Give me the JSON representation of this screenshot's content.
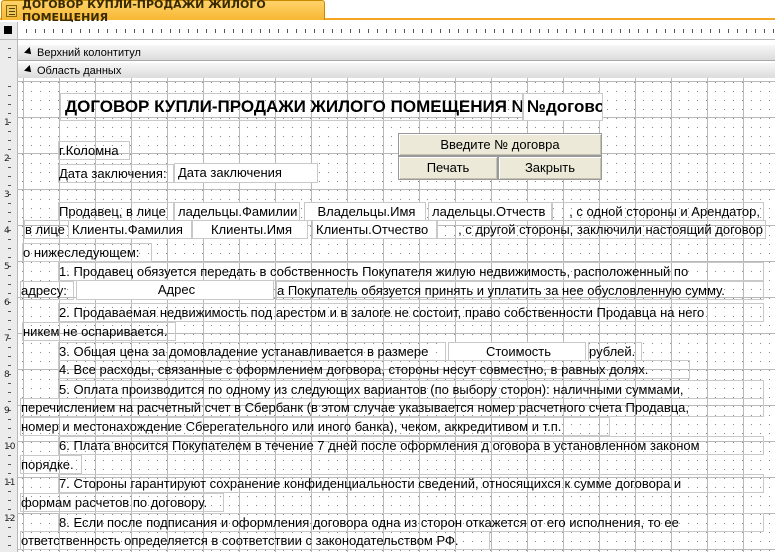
{
  "window": {
    "tab_title": "ДОГОВОР КУПЛИ-ПРОДАЖИ ЖИЛОГО ПОМЕЩЕНИЯ"
  },
  "sections": {
    "header": "Верхний колонтитул",
    "detail": "Область данных"
  },
  "ruler": {
    "numbers": [
      "1",
      "2",
      "3",
      "4",
      "5",
      "6",
      "7",
      "8",
      "9",
      "10",
      "11",
      "12"
    ]
  },
  "form": {
    "title_label": "ДОГОВОР КУПЛИ-ПРОДАЖИ ЖИЛОГО ПОМЕЩЕНИЯ №",
    "contract_no_field": "№догово",
    "city": "г.Коломна",
    "date_label": "Дата заключения:",
    "date_field": "Дата заключения",
    "buttons": {
      "enter_no": "Введите № договра",
      "print": "Печать",
      "close": "Закрыть"
    },
    "line1": {
      "seller_prefix": "Продавец, в лице",
      "owner_last": "ладельцы.Фамилии",
      "owner_first": "Владельцы.Имя",
      "owner_middle": "ладельцы.Отчеств",
      "suffix": ", с одной стороны  и  Арендатор,"
    },
    "line2": {
      "prefix": "в лице",
      "client_last": "Клиенты.Фамилия",
      "client_first": "Клиенты.Имя",
      "client_middle": "Клиенты.Отчество",
      "suffix": ", с другой стороны, заключили настоящий договор"
    },
    "line3": "о нижеследующем:",
    "p1a": "1. Продавец  обязуется передать  в  собственность  Покупателя  жилую недвижимость,  расположенный  по",
    "p1b_prefix": "адресу:",
    "address_field": "Адрес",
    "p1b_suffix": "а Покупатель  обязуется принять и уплатить за нее обусловленную сумму.",
    "p2a": "2. Продаваемая недвижимость под арестом  и  в залоге  не  состоит,  право собственности Продавца на него",
    "p2b": "никем не оспаривается.",
    "p3_prefix": "3.  Общая цена за домовладение устанавливается в размере",
    "price_field": "Стоимость",
    "p3_suffix": "рублей.",
    "p4": "4.  Все  расходы,  связанные  с оформлением  договора, стороны  несут совместно, в равных долях.",
    "p5a": "5. Оплата  производится  по  одному  из  следующих  вариантов  (по  выбору  сторон):  наличными  суммами,",
    "p5b": "перечислением  на  расчетный  счет  в  Сбербанк  (в  этом  случае  указывается  номер  расчетного  счета  Продавца,",
    "p5c": "номер  и местонахождение Сберегательного  или иного банка), чеком, аккредитивом и т.п.",
    "p6a": "6. Плата вносится  Покупателем  в  течение  7  дней  после  оформления д оговора  в установленном  законом",
    "p6b": "порядке.",
    "p7a": "7.  Стороны   гарантируют  сохранение   конфиденциальности  сведений,  относящихся   к  сумме  договора и",
    "p7b": "формам расчетов по договору.",
    "p8a": "8. Если  после  подписания  и  оформления  договора  одна  из  сторон  откажется от его  исполнения,  то ее",
    "p8b": "ответственность  определяется  в соответствии с законодательством РФ."
  }
}
